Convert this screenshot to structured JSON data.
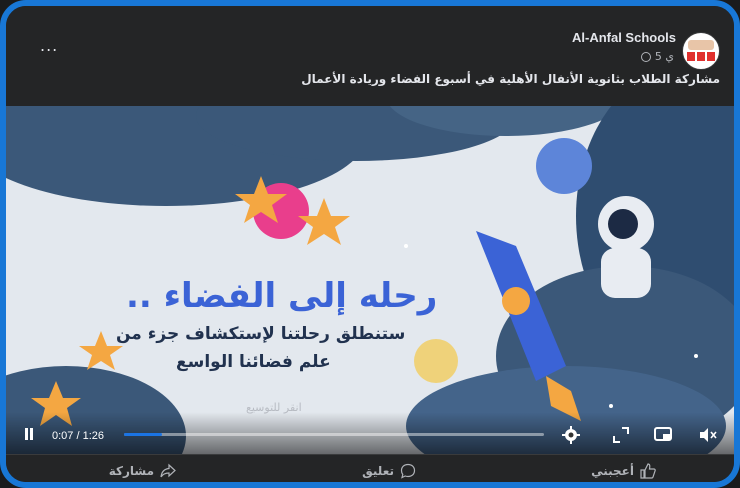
{
  "post": {
    "page_name": "Al-Anfal Schools",
    "time": "5 ي",
    "caption": "مشاركة الطلاب بثانوية الأنفال الأهلية في أسبوع الفضاء وريادة الأعمال",
    "more_label": "..."
  },
  "video": {
    "headline": "رحله إلى الفضاء ..",
    "subtitle_line1": "ستنطلق رحلتنا لإستكشاف جزء من",
    "subtitle_line2": "علم فضائنا الواسع",
    "watermark": "انقر للتوسيع",
    "time_display": "0:07 / 1:26",
    "progress": 0.09
  },
  "actions": {
    "like": "أعجبني",
    "comment": "تعليق",
    "share": "مشاركة"
  },
  "icons": {
    "more": "more-icon",
    "globe": "globe-icon",
    "settings": "gear-icon",
    "fullscreen": "expand-icon",
    "miniplayer": "miniplayer-icon",
    "volume": "volume-muted-icon",
    "like": "thumbs-up-icon",
    "comment": "comment-icon",
    "share": "share-icon"
  },
  "colors": {
    "accent": "#1b74e4",
    "frame": "#1877d6",
    "headline": "#3b63d6"
  }
}
